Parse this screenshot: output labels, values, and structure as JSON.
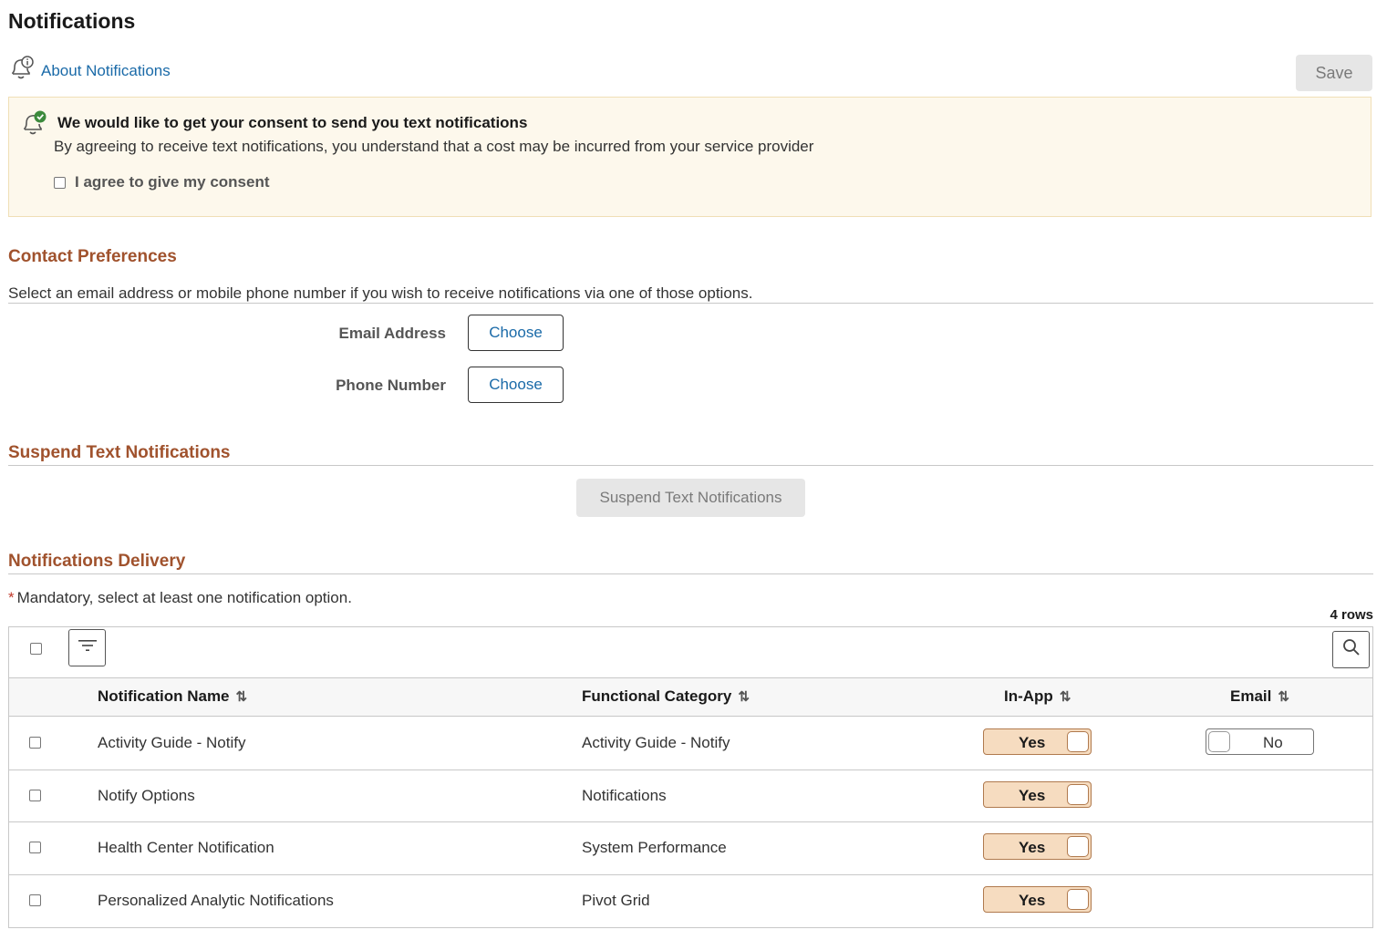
{
  "page": {
    "title": "Notifications"
  },
  "header": {
    "about_link": "About Notifications",
    "save_label": "Save"
  },
  "consent": {
    "title": "We would like to get your consent to send you text notifications",
    "text": "By agreeing to receive text notifications, you understand that a cost may be incurred from your service provider",
    "checkbox_label": "I agree to give my consent"
  },
  "contact": {
    "title": "Contact Preferences",
    "hint": "Select an email address or mobile phone number if you wish to receive notifications via one of those options.",
    "email_label": "Email Address",
    "phone_label": "Phone Number",
    "choose_label": "Choose"
  },
  "suspend": {
    "title": "Suspend Text Notifications",
    "button_label": "Suspend Text Notifications"
  },
  "delivery": {
    "title": "Notifications Delivery",
    "mandatory_star": "*",
    "mandatory_text": "Mandatory, select at least one notification option.",
    "rows_count": "4 rows",
    "columns": {
      "name": "Notification Name",
      "category": "Functional Category",
      "inapp": "In-App",
      "email": "Email"
    },
    "rows": [
      {
        "name": "Activity Guide - Notify",
        "category": "Activity Guide - Notify",
        "inapp": "Yes",
        "email": "No"
      },
      {
        "name": "Notify Options",
        "category": "Notifications",
        "inapp": "Yes"
      },
      {
        "name": "Health Center Notification",
        "category": "System Performance",
        "inapp": "Yes"
      },
      {
        "name": "Personalized Analytic Notifications",
        "category": "Pivot Grid",
        "inapp": "Yes"
      }
    ]
  },
  "colors": {
    "section_title": "#a0522d",
    "link": "#1a6aa8",
    "consent_bg": "#fdf8ec",
    "toggle_on_bg": "#f6dcc0",
    "consent_check_green": "#3c8a3c"
  },
  "icons": {
    "about": "bell-info-icon",
    "consent": "bell-check-icon",
    "filter": "filter-icon",
    "search": "search-icon",
    "sort": "sort-icon"
  }
}
